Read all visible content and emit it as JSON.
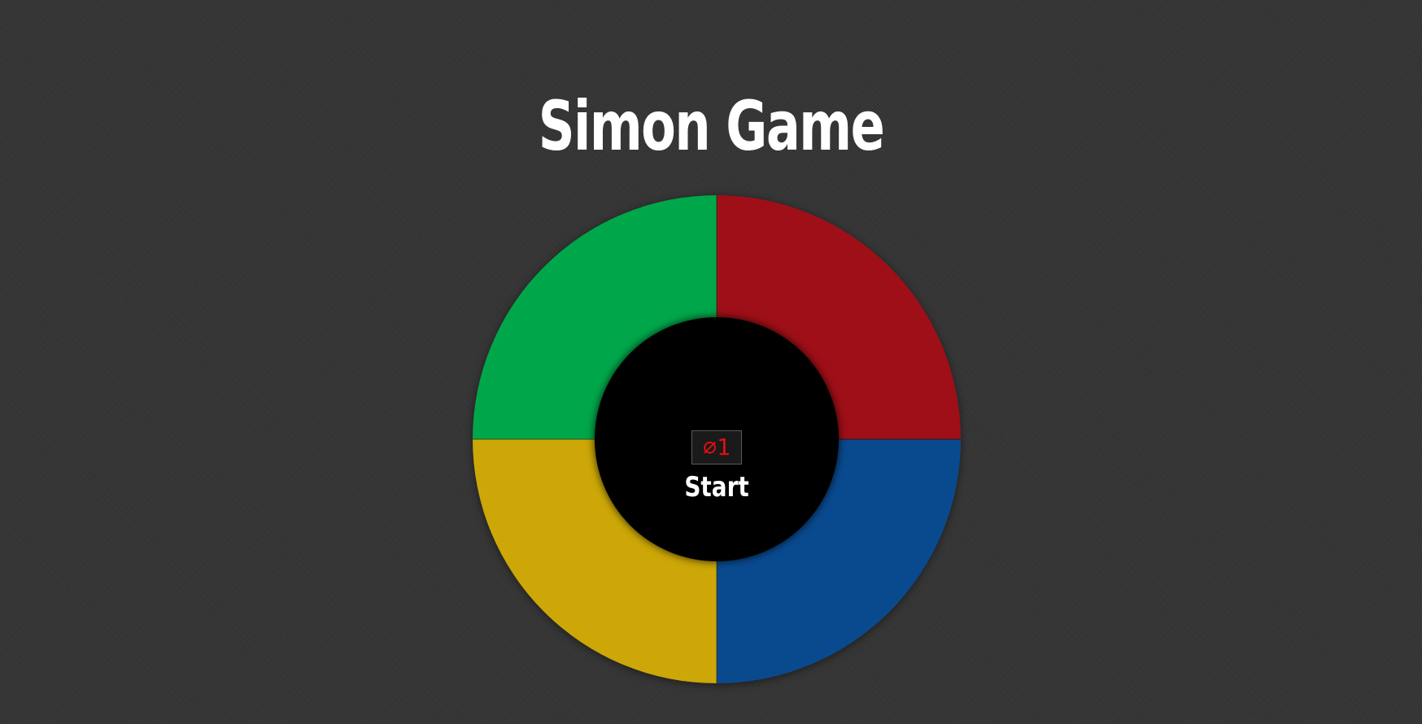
{
  "title": "Simon Game",
  "counter": "⌀1",
  "start_label": "Start",
  "colors": {
    "background": "#353535",
    "green": "#00a74a",
    "red": "#9f0f17",
    "yellow": "#cca707",
    "blue": "#094a8f",
    "center": "#000000",
    "counter_text": "#e01010"
  }
}
